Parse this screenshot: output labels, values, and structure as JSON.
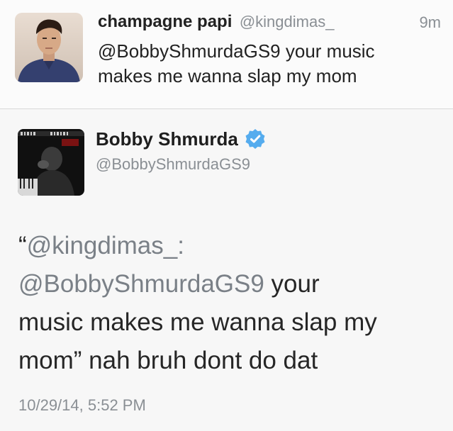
{
  "reply_tweet": {
    "display_name": "champagne papi",
    "handle": "@kingdimas_",
    "time": "9m",
    "text_line1": "@BobbyShmurdaGS9 your music",
    "text_line2": "makes me wanna slap my mom"
  },
  "main_tweet": {
    "display_name": "Bobby Shmurda",
    "handle": "@BobbyShmurdaGS9",
    "verified_icon": "verified-badge-icon",
    "quote_open": "“",
    "quote_mention": "@kingdimas_:",
    "quoted_mention": "@BobbyShmurdaGS9",
    "text_after_mention": " your",
    "text_line3": "music makes me wanna slap my",
    "text_line4": "mom” nah bruh dont do dat",
    "timestamp": "10/29/14, 5:52 PM"
  },
  "colors": {
    "verified_blue": "#55acee",
    "muted_gray": "#8a8f94",
    "text_dark": "#222222"
  }
}
